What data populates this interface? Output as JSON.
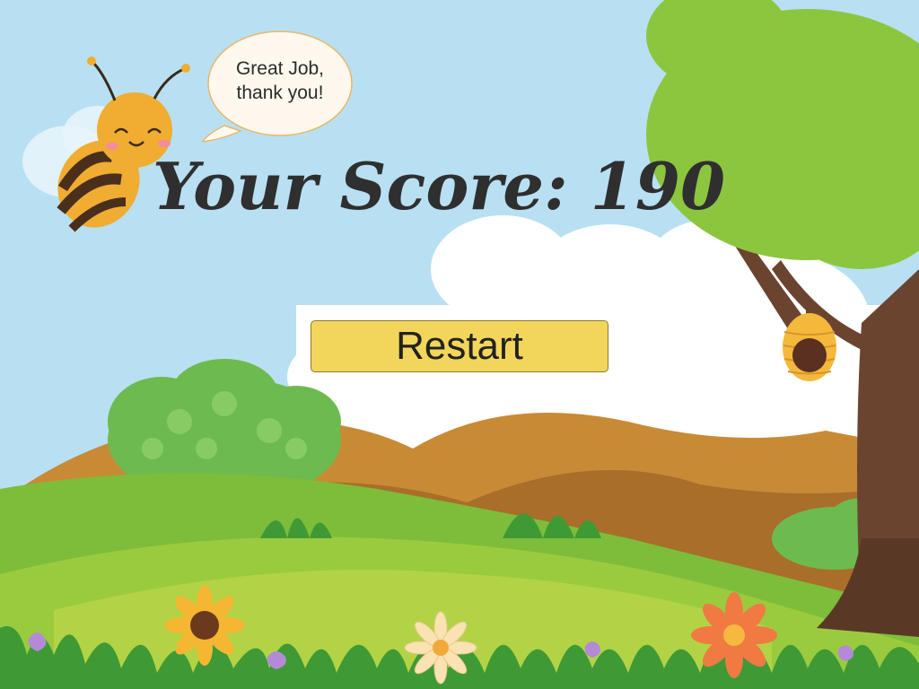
{
  "speech_bubble": {
    "line1": "Great Job,",
    "line2": "thank you!"
  },
  "score": {
    "label": "Your Score:",
    "value": "190"
  },
  "restart_label": "Restart",
  "colors": {
    "sky": "#b8e0f2",
    "button": "#f2d65c",
    "text": "#2f2f2f",
    "bee_body": "#f0ad32",
    "bee_stripe": "#4a2f1c",
    "hill_green": "#8cc63f",
    "tree_trunk": "#6b4430",
    "leaves": "#8cc63f"
  },
  "icons": [
    "bee-icon",
    "speech-bubble",
    "beehive-icon",
    "tree-icon",
    "flower-icon",
    "bush-icon"
  ]
}
